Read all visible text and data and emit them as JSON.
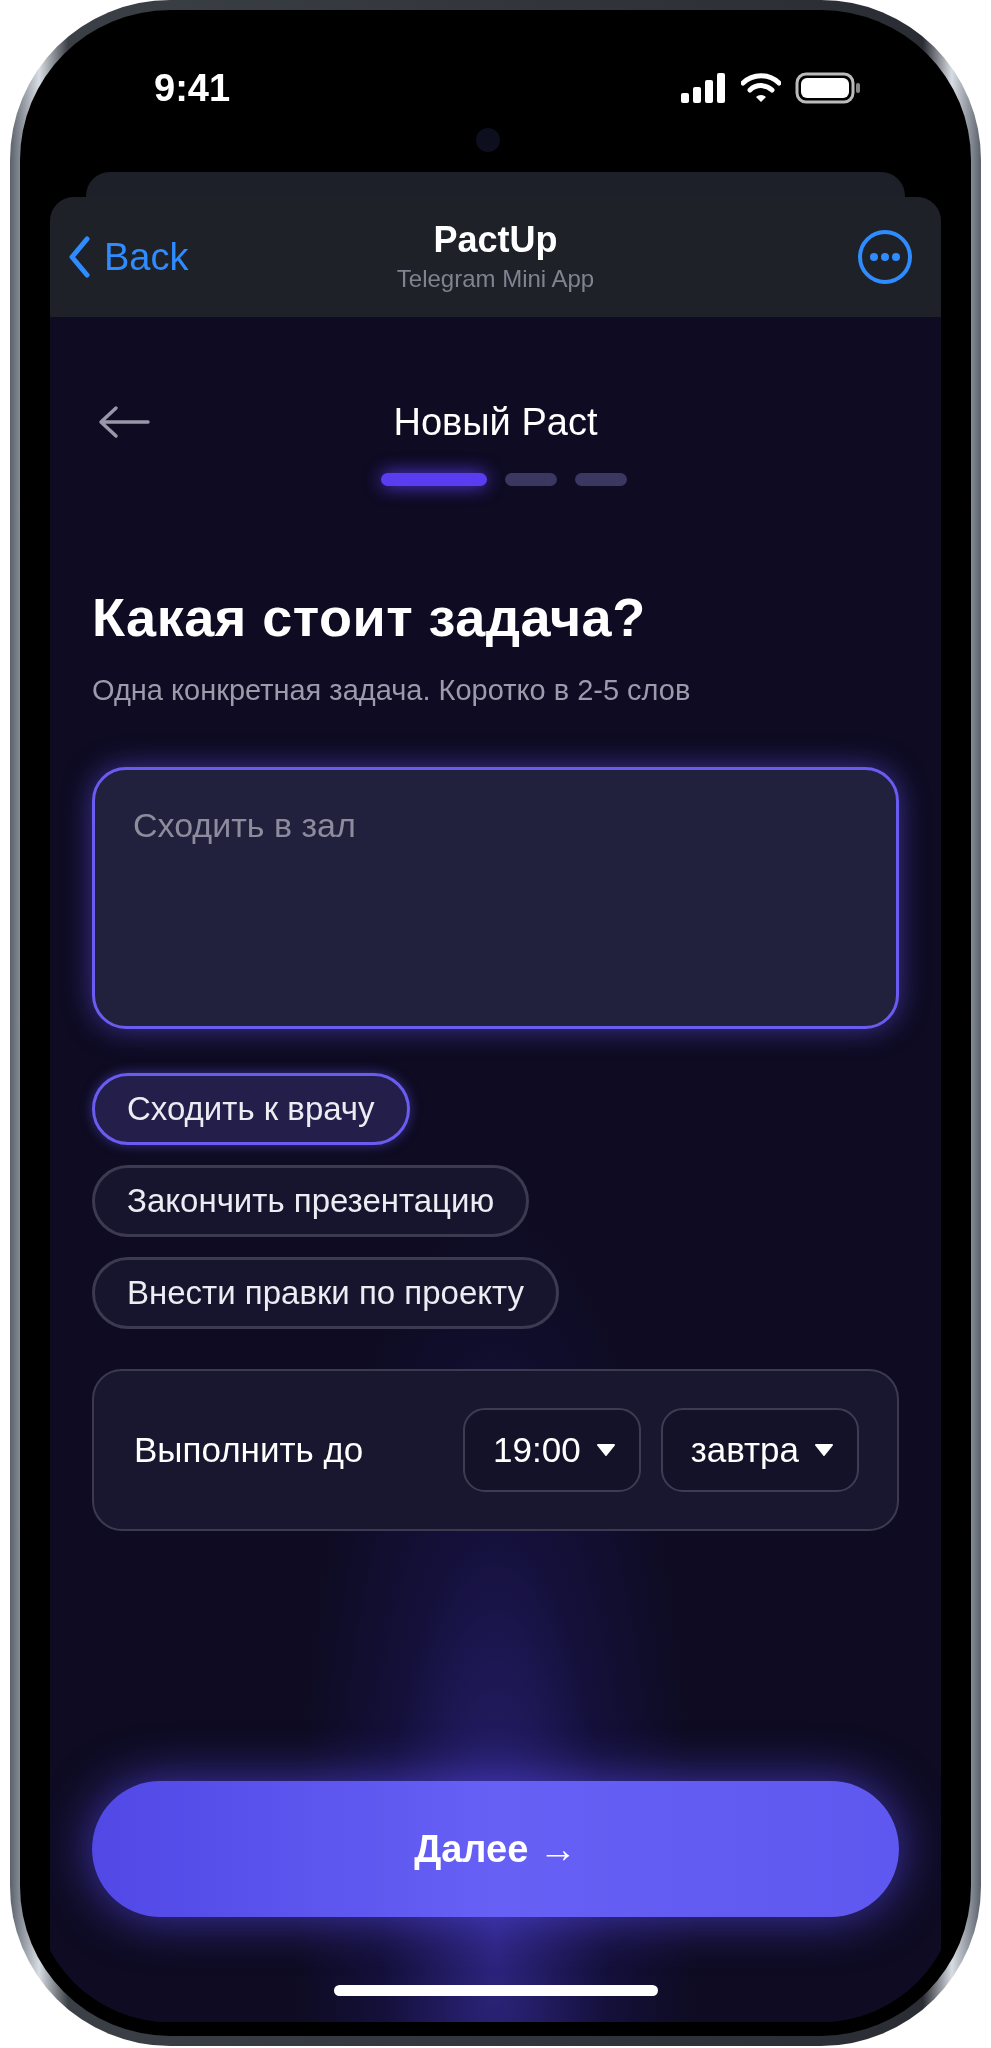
{
  "status_bar": {
    "time": "9:41"
  },
  "telegram_header": {
    "back": "Back",
    "title": "PactUp",
    "subtitle": "Telegram Mini App"
  },
  "screen": {
    "title": "Новый Pact"
  },
  "progress_steps": [
    {
      "selected": true
    },
    {
      "selected": false
    },
    {
      "selected": false
    }
  ],
  "question": {
    "heading": "Какая стоит задача?",
    "hint": "Одна конкретная задача. Коротко в 2-5 слов"
  },
  "task_field": {
    "placeholder": "Сходить в зал"
  },
  "suggestions": [
    {
      "label": "Сходить к врачу",
      "selected": true
    },
    {
      "label": "Закончить презентацию",
      "selected": false
    },
    {
      "label": "Внести правки по проекту",
      "selected": false
    }
  ],
  "deadline": {
    "label": "Выполнить до",
    "time": "19:00",
    "day": "завтра"
  },
  "next_button": "Далее →"
}
